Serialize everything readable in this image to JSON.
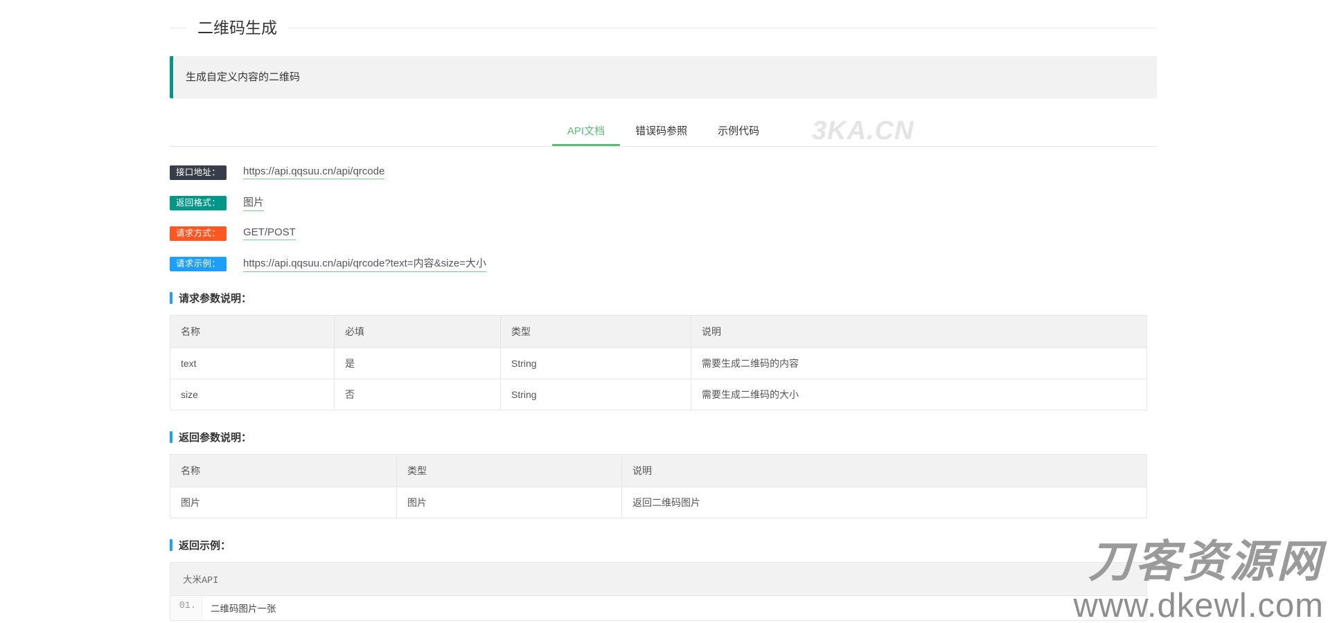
{
  "page": {
    "title": "二维码生成"
  },
  "alert": {
    "text": "生成自定义内容的二维码",
    "accent_color": "#009688"
  },
  "tabs": [
    {
      "label": "API文档",
      "active": true
    },
    {
      "label": "错误码参照",
      "active": false
    },
    {
      "label": "示例代码",
      "active": false
    }
  ],
  "tab_accent_color": "#5FB878",
  "info_rows": [
    {
      "badge": "接口地址：",
      "badge_color": "#393D49",
      "value": "https://api.qqsuu.cn/api/qrcode"
    },
    {
      "badge": "返回格式：",
      "badge_color": "#009688",
      "value": "图片"
    },
    {
      "badge": "请求方式：",
      "badge_color": "#FF5722",
      "value": "GET/POST"
    },
    {
      "badge": "请求示例：",
      "badge_color": "#1E9FFF",
      "value": "https://api.qqsuu.cn/api/qrcode?text=内容&size=大小"
    }
  ],
  "request_section": {
    "heading": "请求参数说明：",
    "headers": [
      "名称",
      "必填",
      "类型",
      "说明"
    ],
    "rows": [
      [
        "text",
        "是",
        "String",
        "需要生成二维码的内容"
      ],
      [
        "size",
        "否",
        "String",
        "需要生成二维码的大小"
      ]
    ]
  },
  "response_section": {
    "heading": "返回参数说明：",
    "headers": [
      "名称",
      "类型",
      "说明"
    ],
    "rows": [
      [
        "图片",
        "图片",
        "返回二维码图片"
      ]
    ]
  },
  "example_section": {
    "heading": "返回示例：",
    "code_title": "大米API",
    "lines": [
      {
        "number": "01.",
        "text": "二维码图片一张"
      }
    ]
  },
  "watermarks": {
    "top": "3KA.CN",
    "bottom_cn": "刀客资源网",
    "bottom_url": "www.dkewl.com"
  }
}
